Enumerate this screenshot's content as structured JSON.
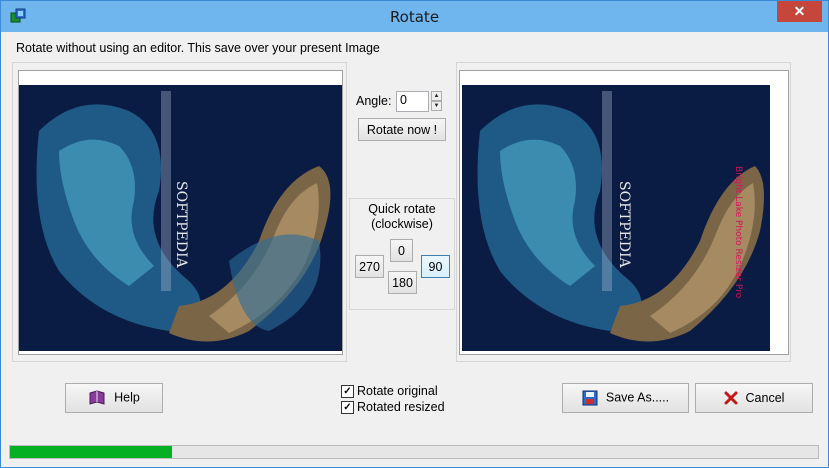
{
  "window": {
    "title": "Rotate",
    "close_glyph": "✕"
  },
  "info_text": "Rotate without using an editor.  This save over your present Image",
  "angle": {
    "label": "Angle:",
    "value": "0"
  },
  "rotate_now_label": "Rotate now !",
  "quick_rotate": {
    "title_line1": "Quick rotate",
    "title_line2": "(clockwise)",
    "btn_0": "0",
    "btn_270": "270",
    "btn_90": "90",
    "btn_180": "180"
  },
  "images": {
    "left_watermark": "SOFTPEDIA",
    "right_watermark": "SOFTPEDIA",
    "right_side_text": "Bright Lake Photo Resizer Pro"
  },
  "buttons": {
    "help": "Help",
    "save_as": "Save As.....",
    "cancel": "Cancel"
  },
  "options": {
    "rotate_original": {
      "label": "Rotate original",
      "checked": true
    },
    "rotated_resized": {
      "label": "Rotated resized",
      "checked": true
    }
  },
  "progress": {
    "value": 0.2
  },
  "colors": {
    "titlebar": "#6fb6ef",
    "progress": "#06b025",
    "close": "#c7463b"
  }
}
